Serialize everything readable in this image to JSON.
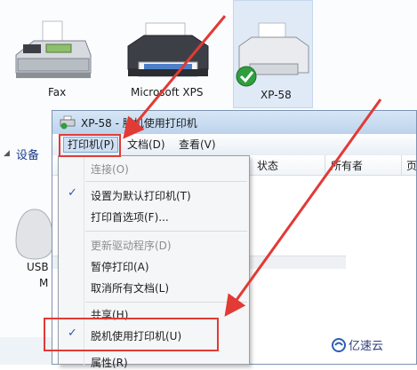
{
  "devices": {
    "items": [
      {
        "label": "Fax",
        "icon": "fax-machine-icon"
      },
      {
        "label": "Microsoft XPS",
        "icon": "printer-icon"
      },
      {
        "label": "XP-58",
        "icon": "default-printer-icon"
      }
    ],
    "printers_section_label": "设备",
    "partial_device_label_1": "USB",
    "partial_device_label_2": "M"
  },
  "window": {
    "title": "XP-58  -  脱机使用打印机",
    "menus": [
      "打印机(P)",
      "文档(D)",
      "查看(V)"
    ],
    "columns": [
      "状态",
      "所有者",
      "页"
    ]
  },
  "printer_menu": {
    "items": [
      {
        "label": "连接(O)",
        "disabled": true,
        "checked": false
      },
      {
        "label": "设置为默认打印机(T)",
        "disabled": false,
        "checked": true
      },
      {
        "label": "打印首选项(F)...",
        "disabled": false,
        "checked": false
      },
      {
        "label": "更新驱动程序(D)",
        "disabled": true,
        "checked": false
      },
      {
        "label": "暂停打印(A)",
        "disabled": false,
        "checked": false
      },
      {
        "label": "取消所有文档(L)",
        "disabled": false,
        "checked": false
      },
      {
        "label": "共享(H)",
        "disabled": false,
        "checked": false
      },
      {
        "label": "脱机使用打印机(U)",
        "disabled": false,
        "checked": true
      },
      {
        "label": "属性(R)",
        "disabled": false,
        "checked": false
      }
    ]
  },
  "watermark": {
    "text": "亿速云"
  },
  "colors": {
    "annotation_red": "#e23a35",
    "highlight_blue": "#cfe0f4"
  }
}
